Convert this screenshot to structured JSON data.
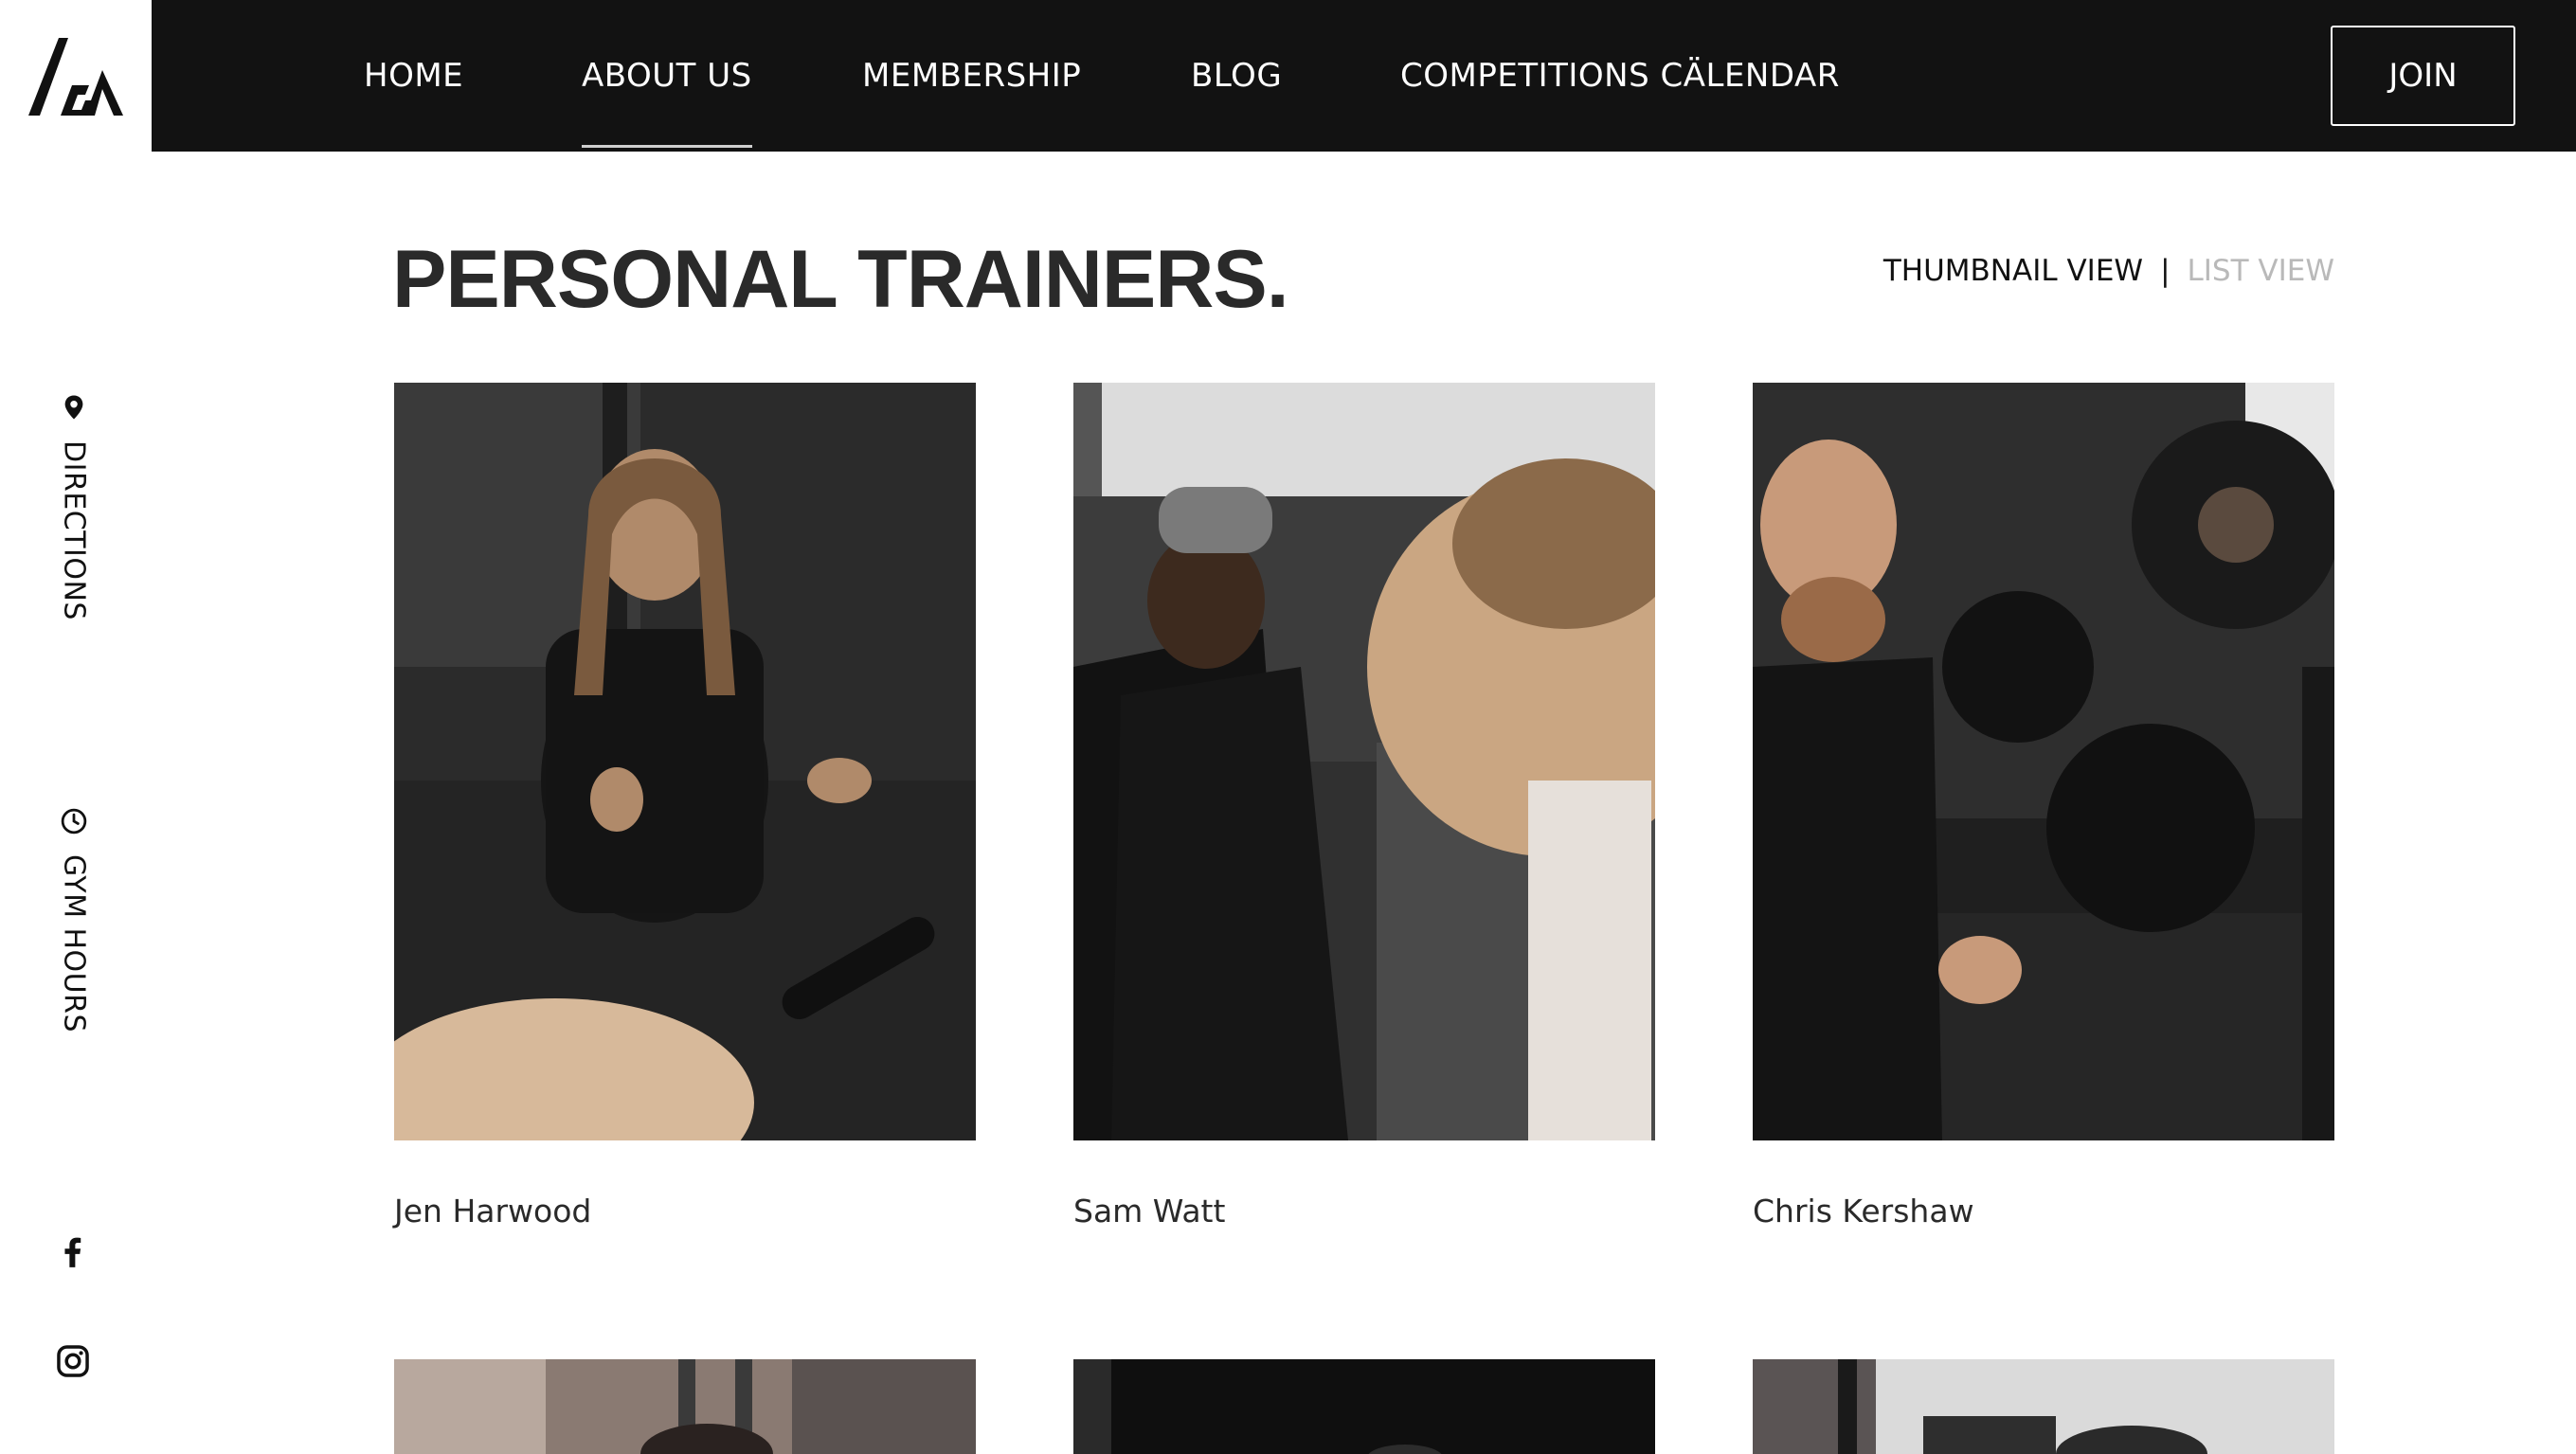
{
  "brand": {
    "logo_icon": "gh-logo-icon",
    "accent": "#121212"
  },
  "nav": {
    "items": [
      {
        "label": "HOME",
        "active": false
      },
      {
        "label": "ABOUT US",
        "active": true
      },
      {
        "label": "MEMBERSHIP",
        "active": false
      },
      {
        "label": "BLOG",
        "active": false
      },
      {
        "label": "COMPETITIONS CÄLENDAR",
        "active": false
      }
    ],
    "join_label": "JOIN"
  },
  "sidebar": {
    "directions": {
      "label": "DIRECTIONS",
      "icon": "map-pin-icon"
    },
    "gym_hours": {
      "label": "GYM HOURS",
      "icon": "clock-icon"
    },
    "social": [
      {
        "icon": "facebook-icon"
      },
      {
        "icon": "instagram-icon"
      }
    ]
  },
  "page": {
    "title": "PERSONAL TRAINERS.",
    "view_toggle": {
      "thumbnail": "THUMBNAIL VIEW",
      "separator": "|",
      "list": "LIST VIEW"
    }
  },
  "trainers": [
    {
      "name": "Jen Harwood"
    },
    {
      "name": "Sam Watt"
    },
    {
      "name": "Chris Kershaw"
    }
  ],
  "colors": {
    "bar": "#121212",
    "muted": "#b9b9b9",
    "text": "#2a2a2a"
  }
}
